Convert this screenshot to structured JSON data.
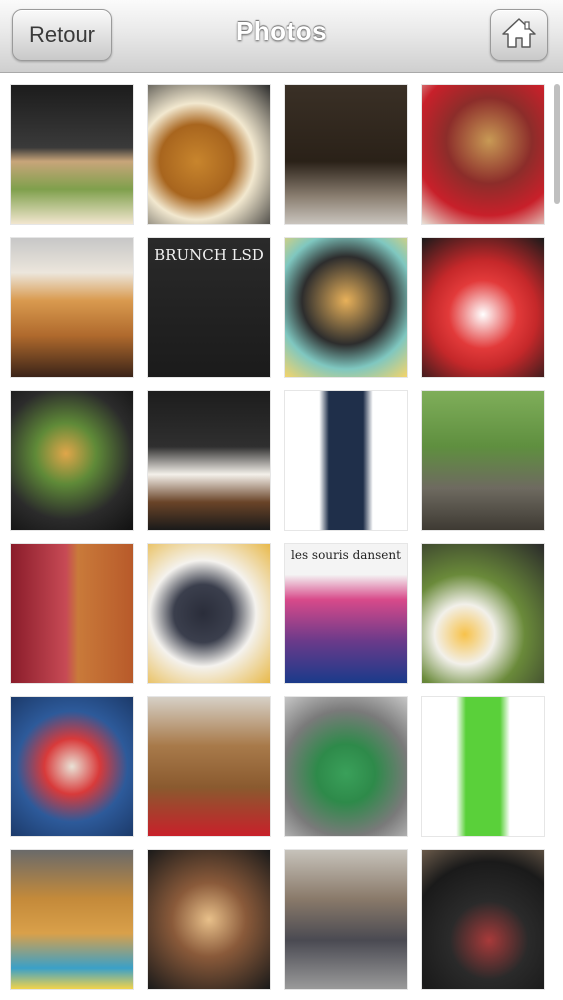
{
  "header": {
    "title": "Photos",
    "back_label": "Retour",
    "home_icon": "home-icon"
  },
  "photos": [
    {
      "name": "photo-chef-sandwich-salad",
      "bg": "linear-gradient(#1c1c1c 0%, #3a3a3a 45%, #c8a57a 55%, #7fa04c 75%, #f2e6cf 100%)",
      "overlay": ""
    },
    {
      "name": "photo-fried-chicken-eggs",
      "bg": "radial-gradient(circle at 40% 55%, #c8852d 0%, #a8651e 35%, #f2e8cf 55%, #2c2c2c 100%)",
      "overlay": ""
    },
    {
      "name": "photo-restaurant-facade",
      "bg": "linear-gradient(#3a3026 0%, #2a2118 55%, #8a7e70 80%, #c9c4bd 100%)",
      "overlay": ""
    },
    {
      "name": "photo-burger-fries-plate",
      "bg": "radial-gradient(circle at 55% 40%, #c89a55 0%, #8c2d2a 40%, #c8202a 70%, #e9e1d6 100%)",
      "overlay": ""
    },
    {
      "name": "photo-honey-toast",
      "bg": "linear-gradient(#c7c7c7 0%, #ece6dc 25%, #d99a4f 45%, #b06a2d 70%, #3b2418 100%)",
      "overlay": ""
    },
    {
      "name": "photo-brunch-chalkboard",
      "bg": "linear-gradient(#2a2a2a, #1b1b1b)",
      "overlay": "BRUNCH LSD"
    },
    {
      "name": "photo-brunch-spread",
      "bg": "radial-gradient(circle at 50% 45%, #e8b15a 0%, #2d2d2d 45%, #7fc7c0 70%, #f4d46a 100%)",
      "overlay": ""
    },
    {
      "name": "photo-bunny-dessert",
      "bg": "radial-gradient(circle at 50% 55%, #ffffff 0%, #e23a3a 35%, #c5282a 55%, #1a1a1a 100%)",
      "overlay": ""
    },
    {
      "name": "photo-salad-bowl",
      "bg": "radial-gradient(circle at 45% 45%, #e0a64a 0%, #5f8a38 30%, #2b2b2b 65%, #111 100%)",
      "overlay": ""
    },
    {
      "name": "photo-chocolate-dessert",
      "bg": "linear-gradient(#1d1d1d 0%, #2f2f2f 40%, #f4f0ea 60%, #6a4428 80%, #1a1a1a 100%)",
      "overlay": ""
    },
    {
      "name": "photo-black-roll-cake",
      "bg": "linear-gradient(90deg, #ffffff 0%, #ffffff 28%, #1f2f4a 36%, #1f2f4a 64%, #ffffff 72%, #ffffff 100%)",
      "overlay": ""
    },
    {
      "name": "photo-street-trees",
      "bg": "linear-gradient(#7fae5a 0%, #5f8f3f 40%, #6e6a60 70%, #3e3a33 100%)",
      "overlay": ""
    },
    {
      "name": "photo-drink-hotdog",
      "bg": "linear-gradient(90deg, #8a1c2a 0%, #c74a55 45%, #c97a3a 55%, #b85a2a 100%)",
      "overlay": ""
    },
    {
      "name": "photo-black-roll-slice",
      "bg": "radial-gradient(circle at 45% 50%, #2a2d3a 0%, #3b3f4d 30%, #f4f2ee 55%, #e8b94a 100%)",
      "overlay": ""
    },
    {
      "name": "photo-les-souris-poster",
      "bg": "linear-gradient(#f4f4f4 0%, #f4f4f4 22%, #d84a8a 40%, #6a3a8a 70%, #1a3a8a 100%)",
      "overlay": "les souris dansent"
    },
    {
      "name": "photo-fried-egg-salad",
      "bg": "radial-gradient(circle at 35% 65%, #f7c24a 0%, #f2f0ea 25%, #6a8a3a 50%, #2a2a2a 100%)",
      "overlay": ""
    },
    {
      "name": "photo-fruit-bowl",
      "bg": "radial-gradient(circle at 50% 50%, #e9e2d6 0%, #d83a3a 30%, #2d5a9a 60%, #1c3a6a 100%)",
      "overlay": ""
    },
    {
      "name": "photo-fried-dumplings",
      "bg": "linear-gradient(#d6d0c6 0%, #a87a4a 35%, #8a5a2f 65%, #c8202a 100%)",
      "overlay": ""
    },
    {
      "name": "photo-matcha-cup",
      "bg": "radial-gradient(circle at 50% 55%, #3aa05a 0%, #2e8a4a 30%, #7a7a7a 65%, #c6c6c6 100%)",
      "overlay": ""
    },
    {
      "name": "photo-green-roll",
      "bg": "linear-gradient(90deg, #ffffff 0%, #ffffff 28%, #5ad03a 36%, #5ad03a 64%, #ffffff 72%, #ffffff 100%)",
      "overlay": ""
    },
    {
      "name": "photo-burger-nuggets",
      "bg": "linear-gradient(#6a6a6a 0%, #c48a3a 35%, #d9a04a 60%, #3aa0c8 85%, #f2d34a 100%)",
      "overlay": ""
    },
    {
      "name": "photo-tacos-board",
      "bg": "radial-gradient(circle at 50% 50%, #e8c08a 0%, #8a5a3a 40%, #1a1a1a 100%)",
      "overlay": ""
    },
    {
      "name": "photo-street-people",
      "bg": "linear-gradient(#c6c2ba 0%, #8a7a6a 35%, #4a4a52 65%, #9a9a9a 100%)",
      "overlay": ""
    },
    {
      "name": "photo-wine-dishes",
      "bg": "radial-gradient(circle at 55% 65%, #a83a3a 0%, #2a2a2a 35%, #1a1a1a 70%, #6a5a4a 100%)",
      "overlay": ""
    }
  ]
}
